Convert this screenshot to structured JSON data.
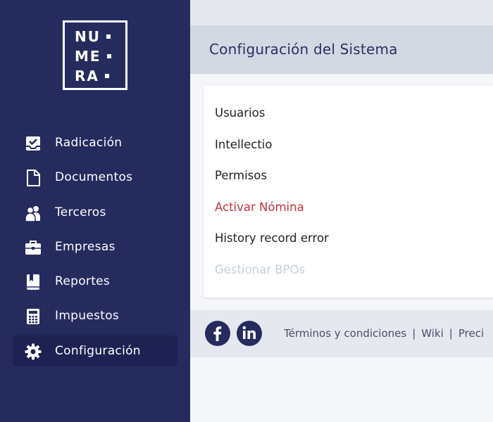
{
  "logo": {
    "lines": [
      "NU",
      "ME",
      "RA"
    ]
  },
  "sidebar": {
    "items": [
      {
        "label": "Radicación",
        "icon": "check-inbox-icon"
      },
      {
        "label": "Documentos",
        "icon": "document-icon"
      },
      {
        "label": "Terceros",
        "icon": "users-icon"
      },
      {
        "label": "Empresas",
        "icon": "briefcase-icon"
      },
      {
        "label": "Reportes",
        "icon": "book-icon"
      },
      {
        "label": "Impuestos",
        "icon": "calculator-icon"
      },
      {
        "label": "Configuración",
        "icon": "gear-icon",
        "active": true
      }
    ]
  },
  "header": {
    "title": "Configuración del Sistema"
  },
  "settings": {
    "options": [
      {
        "label": "Usuarios"
      },
      {
        "label": "Intellectio"
      },
      {
        "label": "Permisos"
      },
      {
        "label": "Activar Nómina",
        "color": "#c3343b"
      },
      {
        "label": "History record error"
      },
      {
        "label": "Gestionar BPOs",
        "disabled": true
      }
    ]
  },
  "footer": {
    "social": [
      "facebook-icon",
      "linkedin-icon"
    ],
    "links": [
      "Términos y condiciones",
      "Wiki",
      "Preci"
    ]
  },
  "colors": {
    "sidebar": "#262b5e",
    "active_item": "#1d2252",
    "accent_red": "#c3343b",
    "disabled_text": "#c4cfdc"
  }
}
